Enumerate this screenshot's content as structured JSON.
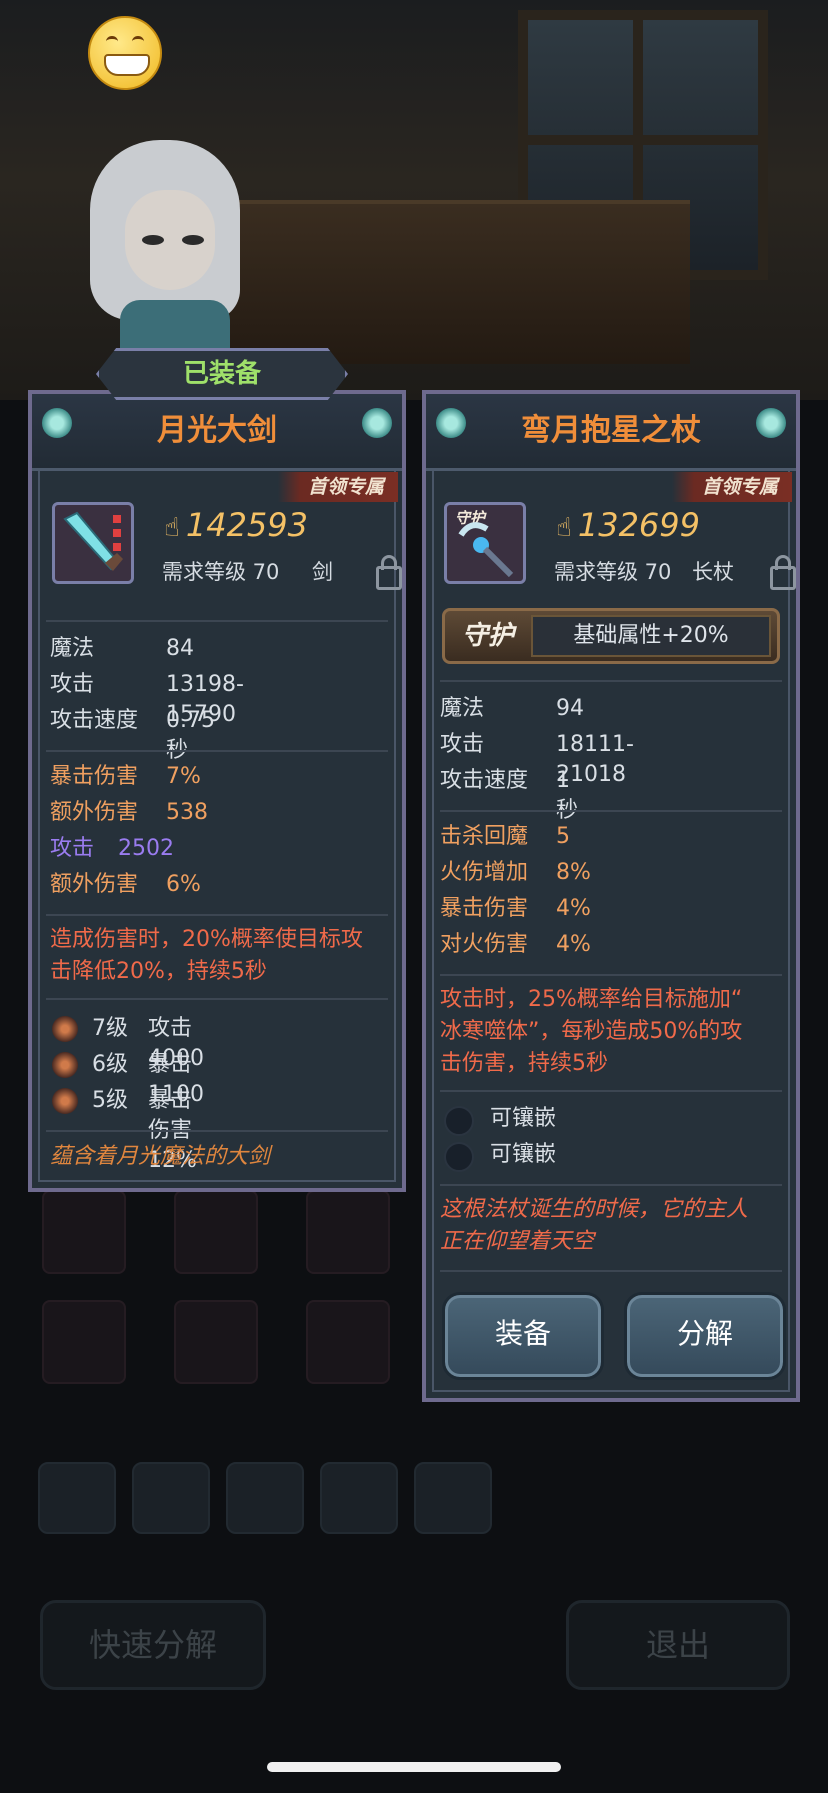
{
  "status_emoji": "grinning-face",
  "left_card": {
    "badge": "已装备",
    "title": "月光大剑",
    "ribbon": "首领专属",
    "power": "142593",
    "req_level": "需求等级 70",
    "weapon_type": "剑",
    "base_stats": [
      {
        "k": "魔法",
        "v": "84"
      },
      {
        "k": "攻击",
        "v": "13198-15790"
      },
      {
        "k": "攻击速度",
        "v": "0.75秒"
      }
    ],
    "bonus_stats": [
      {
        "k": "暴击伤害",
        "v": "7%",
        "color": "orange"
      },
      {
        "k": "额外伤害",
        "v": "538",
        "color": "orange"
      },
      {
        "k": "攻击",
        "v": "2502",
        "color": "purple"
      },
      {
        "k": "额外伤害",
        "v": "6%",
        "color": "orange"
      }
    ],
    "effect": "造成伤害时，20%概率使目标攻击降低20%，持续5秒",
    "effect_line1": "造成伤害时，20%概率使目标攻",
    "effect_line2": "击降低20%，持续5秒",
    "gems": [
      {
        "level": "7级",
        "stat": "攻击 4000"
      },
      {
        "level": "6级",
        "stat": "暴击 1100"
      },
      {
        "level": "5级",
        "stat": "暴击伤害 12%"
      }
    ],
    "flavor": "蕴含着月光魔法的大剑"
  },
  "right_card": {
    "title": "弯月抱星之杖",
    "ribbon": "首领专属",
    "icon_label": "守护",
    "power": "132699",
    "req_level": "需求等级 70",
    "weapon_type": "长杖",
    "guard_tag": "守护",
    "guard_value": "基础属性+20%",
    "base_stats": [
      {
        "k": "魔法",
        "v": "94"
      },
      {
        "k": "攻击",
        "v": "18111-21018"
      },
      {
        "k": "攻击速度",
        "v": "1秒"
      }
    ],
    "bonus_stats": [
      {
        "k": "击杀回魔",
        "v": "5"
      },
      {
        "k": "火伤增加",
        "v": "8%"
      },
      {
        "k": "暴击伤害",
        "v": "4%"
      },
      {
        "k": "对火伤害",
        "v": "4%"
      }
    ],
    "effect_line1": "攻击时，25%概率给目标施加“",
    "effect_line2": "冰寒噬体”，每秒造成50%的攻",
    "effect_line3": "击伤害，持续5秒",
    "sockets": [
      "可镶嵌",
      "可镶嵌"
    ],
    "flavor_line1": "这根法杖诞生的时候，它的主人",
    "flavor_line2": "正在仰望着天空",
    "equip_button": "装备",
    "dismantle_button": "分解"
  },
  "background_buttons": {
    "quick_dismantle": "快速分解",
    "exit": "退出"
  },
  "colors": {
    "title_orange": "#f08e3a",
    "power_gold": "#f4c166",
    "effect_red": "#f06a4a",
    "stat_orange": "#f0a060",
    "stat_purple": "#9a7cf0",
    "equipped_green": "#9fe06a",
    "panel_bg": "#26313a"
  }
}
